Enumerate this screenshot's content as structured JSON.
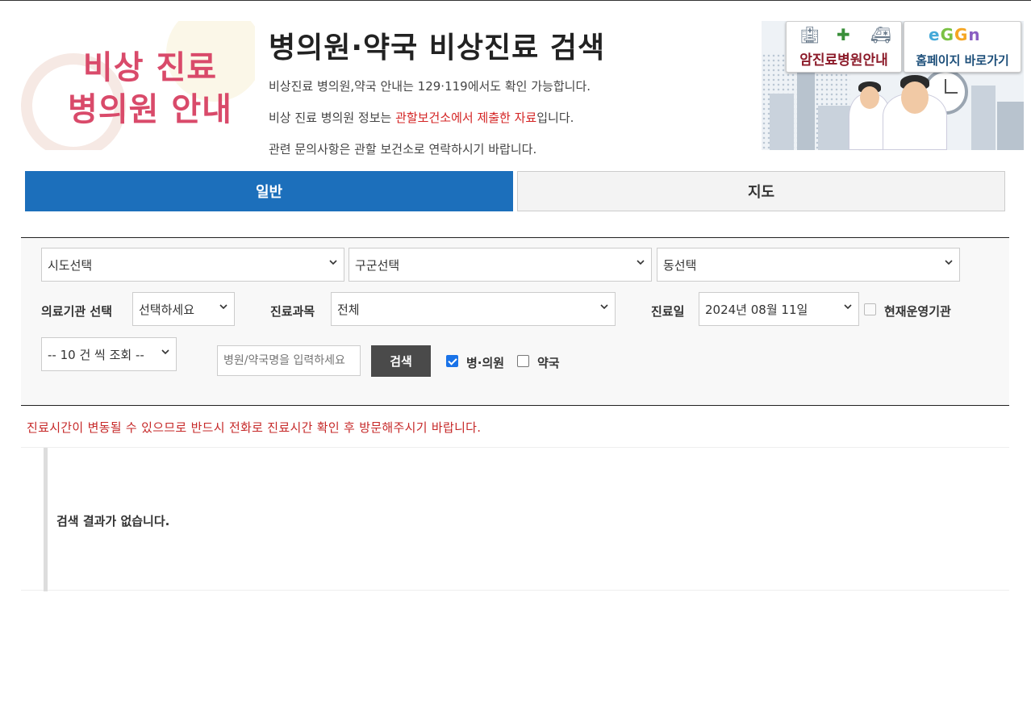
{
  "header": {
    "logo_line1": "비상 진료",
    "logo_line2": "병의원 안내",
    "title": "병의원·약국 비상진료 검색",
    "desc1": "비상진료 병의원,약국 안내는 129·119에서도 확인 가능합니다.",
    "desc2_pre": "비상 진료 병의원 정보는 ",
    "desc2_highlight": "관할보건소에서 제출한 자료",
    "desc2_post": "입니다.",
    "desc3": "관련 문의사항은 관할 보건소로 연락하시기 바랍니다.",
    "accent_red": "#d42424"
  },
  "banner": {
    "card1_label": "암진료병원안내",
    "card2_label": "홈페이지 바로가기",
    "card2_logo": [
      "e",
      "G",
      "G",
      "n"
    ]
  },
  "tabs": [
    {
      "label": "일반",
      "active": true,
      "color": "#1c6fbb"
    },
    {
      "label": "지도",
      "active": false
    }
  ],
  "search": {
    "sido": "시도선택",
    "gugun": "구군선택",
    "dong": "동선택",
    "inst_label": "의료기관 선택",
    "inst_value": "선택하세요",
    "dept_label": "진료과목",
    "dept_value": "전체",
    "date_label": "진료일",
    "date_value": "2024년 08월 11일",
    "operating_label": "현재운영기관",
    "operating_checked": false,
    "page_size": "-- 10 건 씩 조회 --",
    "name_placeholder": "병원/약국명을 입력하세요",
    "search_button": "검색",
    "hospital_label": "병·의원",
    "hospital_checked": true,
    "pharmacy_label": "약국",
    "pharmacy_checked": false
  },
  "notice": "진료시간이 변동될 수 있으므로 반드시 전화로 진료시간 확인 후 방문해주시기 바랍니다.",
  "results": {
    "empty_message": "검색 결과가 없습니다."
  }
}
